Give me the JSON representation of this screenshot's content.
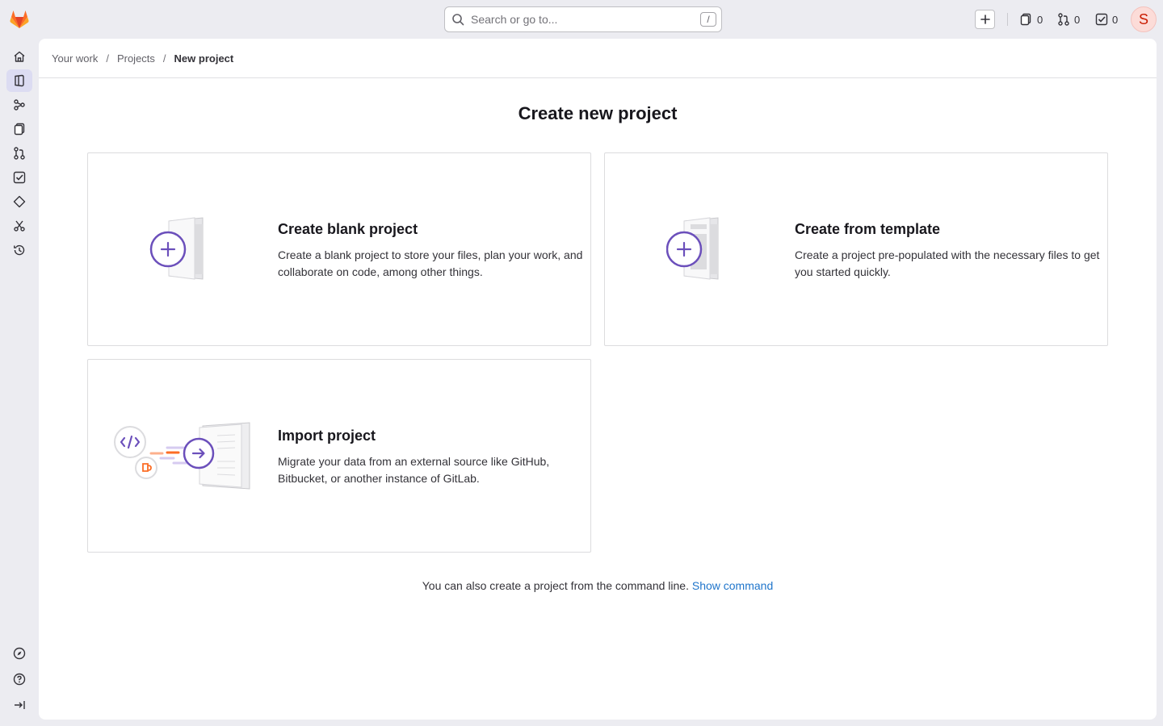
{
  "search": {
    "placeholder": "Search or go to...",
    "shortcut": "/"
  },
  "topbar": {
    "issues_count": "0",
    "merge_requests_count": "0",
    "todos_count": "0",
    "avatar_initial": "S"
  },
  "breadcrumb": {
    "items": [
      "Your work",
      "Projects"
    ],
    "current": "New project"
  },
  "page": {
    "title": "Create new project"
  },
  "cards": [
    {
      "title": "Create blank project",
      "description": "Create a blank project to store your files, plan your work, and collaborate on code, among other things."
    },
    {
      "title": "Create from template",
      "description": "Create a project pre-populated with the necessary files to get you started quickly."
    },
    {
      "title": "Import project",
      "description": "Migrate your data from an external source like GitHub, Bitbucket, or another instance of GitLab."
    }
  ],
  "footer": {
    "text": "You can also create a project from the command line.",
    "link": "Show command"
  },
  "colors": {
    "accent": "#6b4fbb",
    "link": "#1f75cb",
    "rail_active": "#dcdcf2"
  },
  "icons": {
    "rail": [
      "home-icon",
      "project-icon",
      "groups-icon",
      "snippets-icon",
      "merge-request-icon",
      "todo-icon",
      "milestone-icon",
      "snippet-scissors-icon",
      "activity-icon"
    ],
    "rail_bottom": [
      "explore-icon",
      "help-icon",
      "collapse-sidebar-icon"
    ]
  }
}
